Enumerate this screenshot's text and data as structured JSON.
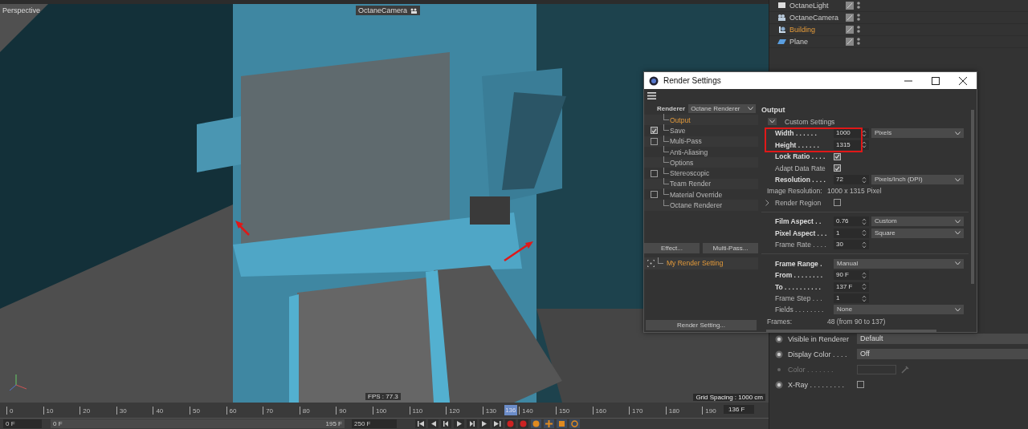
{
  "viewport": {
    "label": "Perspective",
    "camera": "OctaneCamera",
    "fps": "FPS : 77.3",
    "grid_spacing": "Grid Spacing : 1000 cm"
  },
  "objects": [
    {
      "name": "OctaneLight",
      "selected": false,
      "kind": "light"
    },
    {
      "name": "OctaneCamera",
      "selected": false,
      "kind": "camera"
    },
    {
      "name": "Building",
      "selected": true,
      "kind": "group"
    },
    {
      "name": "Plane",
      "selected": false,
      "kind": "plane"
    }
  ],
  "attributes": [
    {
      "label": "Visible in Renderer",
      "kind": "dropdown",
      "value": "Default"
    },
    {
      "label": "Display Color . . . .",
      "kind": "dropdown",
      "value": "Off"
    },
    {
      "label": "Color . . . . . . .",
      "kind": "color",
      "disabled": true
    },
    {
      "label": "X-Ray . . . . . . . . .",
      "kind": "check",
      "checked": false
    }
  ],
  "dialog": {
    "title": "Render Settings",
    "renderer_label": "Renderer",
    "renderer": "Octane Renderer",
    "tree": [
      {
        "label": "Output",
        "kind": "plain",
        "selected": true
      },
      {
        "label": "Save",
        "kind": "toggle",
        "checked": true,
        "selected": false
      },
      {
        "label": "Multi-Pass",
        "kind": "toggle",
        "checked": false,
        "selected": false
      },
      {
        "label": "Anti-Aliasing",
        "kind": "plain",
        "selected": false
      },
      {
        "label": "Options",
        "kind": "plain",
        "selected": false
      },
      {
        "label": "Stereoscopic",
        "kind": "toggle",
        "checked": false,
        "selected": false
      },
      {
        "label": "Team Render",
        "kind": "plain",
        "selected": false
      },
      {
        "label": "Material Override",
        "kind": "toggle",
        "checked": false,
        "selected": false
      },
      {
        "label": "Octane Renderer",
        "kind": "plain",
        "selected": false
      }
    ],
    "effect_button": "Effect...",
    "multipass_button": "Multi-Pass...",
    "setting": "My Render Setting",
    "render_setting_button": "Render Setting...",
    "section": "Output",
    "fields": [
      {
        "kind": "group",
        "label": "Custom Settings",
        "expanded": true
      },
      {
        "kind": "number",
        "label": "Width . . . . . .",
        "bold": true,
        "value": "1000",
        "unit": "Pixels",
        "highlighted": true
      },
      {
        "kind": "number",
        "label": "Height . . . . . .",
        "bold": true,
        "value": "1315",
        "highlighted": true
      },
      {
        "kind": "check",
        "label": "Lock Ratio . . . .",
        "bold": true,
        "checked": true
      },
      {
        "kind": "check",
        "label": "Adapt Data Rate",
        "bold": false,
        "checked": true
      },
      {
        "kind": "number",
        "label": "Resolution . . . .",
        "bold": true,
        "value": "72",
        "unit": "Pixels/Inch (DPI)"
      },
      {
        "kind": "info",
        "label": "Image Resolution:",
        "value": "1000 x 1315 Pixel"
      },
      {
        "kind": "check",
        "label": "Render Region",
        "bold": false,
        "checked": false,
        "expanded": false
      },
      {
        "kind": "separator"
      },
      {
        "kind": "number",
        "label": "Film Aspect . .",
        "bold": true,
        "value": "0.76",
        "unit": "Custom"
      },
      {
        "kind": "number",
        "label": "Pixel Aspect . . .",
        "bold": true,
        "value": "1",
        "unit": "Square"
      },
      {
        "kind": "number",
        "label": "Frame Rate . . . .",
        "bold": false,
        "value": "30"
      },
      {
        "kind": "separator"
      },
      {
        "kind": "select",
        "label": "Frame Range .",
        "bold": true,
        "value": "Manual"
      },
      {
        "kind": "number",
        "label": "From . . . . . . . .",
        "bold": true,
        "value": "90 F"
      },
      {
        "kind": "number",
        "label": "To . . . . . . . . . .",
        "bold": true,
        "value": "137 F"
      },
      {
        "kind": "number",
        "label": "Frame Step . . .",
        "bold": false,
        "value": "1"
      },
      {
        "kind": "select",
        "label": "Fields . . . . . . . .",
        "bold": false,
        "value": "None"
      },
      {
        "kind": "info",
        "label": "Frames:",
        "value": "48 (from 90 to 137)"
      }
    ]
  },
  "timeline": {
    "ticks": [
      "0",
      "10",
      "20",
      "30",
      "40",
      "50",
      "60",
      "70",
      "80",
      "90",
      "100",
      "110",
      "120",
      "130",
      "140",
      "150",
      "160",
      "170",
      "180",
      "190"
    ],
    "current_frame": "136",
    "frame_field": "136 F",
    "start_field": "0 F",
    "range": {
      "start": "0 F",
      "end": "195 F",
      "level": 1
    },
    "end_field": "250 F"
  }
}
